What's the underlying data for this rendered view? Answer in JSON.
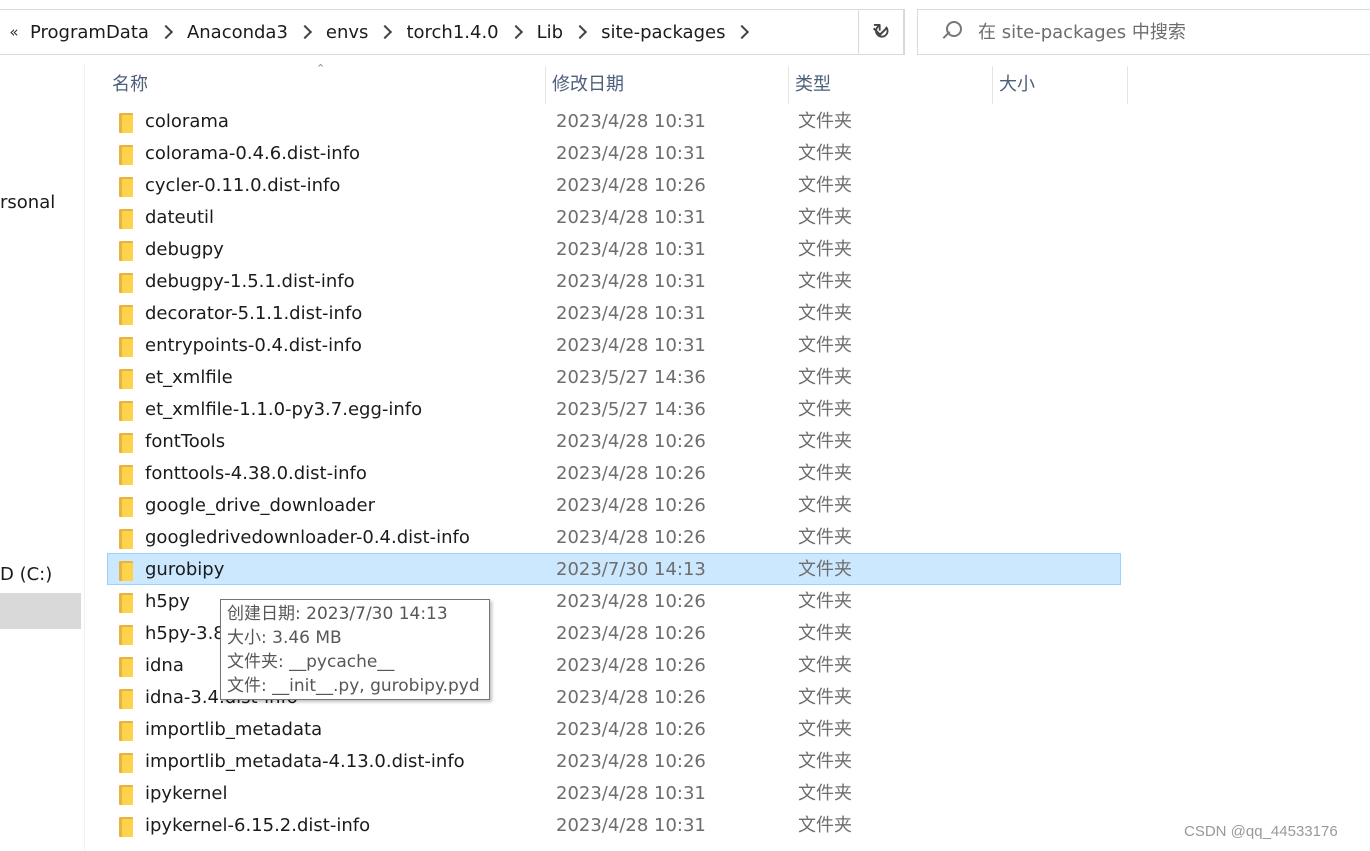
{
  "breadcrumb": [
    "ProgramData",
    "Anaconda3",
    "envs",
    "torch1.4.0",
    "Lib",
    "site-packages"
  ],
  "overflow_glyph": "«",
  "search": {
    "placeholder": "在 site-packages 中搜索"
  },
  "nav": {
    "items": [
      "rsonal",
      "D (C:)"
    ]
  },
  "columns": {
    "name": "名称",
    "date": "修改日期",
    "type": "类型",
    "size": "大小"
  },
  "rows": [
    {
      "name": "colorama",
      "date": "2023/4/28 10:31",
      "type": "文件夹"
    },
    {
      "name": "colorama-0.4.6.dist-info",
      "date": "2023/4/28 10:31",
      "type": "文件夹"
    },
    {
      "name": "cycler-0.11.0.dist-info",
      "date": "2023/4/28 10:26",
      "type": "文件夹"
    },
    {
      "name": "dateutil",
      "date": "2023/4/28 10:31",
      "type": "文件夹"
    },
    {
      "name": "debugpy",
      "date": "2023/4/28 10:31",
      "type": "文件夹"
    },
    {
      "name": "debugpy-1.5.1.dist-info",
      "date": "2023/4/28 10:31",
      "type": "文件夹"
    },
    {
      "name": "decorator-5.1.1.dist-info",
      "date": "2023/4/28 10:31",
      "type": "文件夹"
    },
    {
      "name": "entrypoints-0.4.dist-info",
      "date": "2023/4/28 10:31",
      "type": "文件夹"
    },
    {
      "name": "et_xmlfile",
      "date": "2023/5/27 14:36",
      "type": "文件夹"
    },
    {
      "name": "et_xmlfile-1.1.0-py3.7.egg-info",
      "date": "2023/5/27 14:36",
      "type": "文件夹"
    },
    {
      "name": "fontTools",
      "date": "2023/4/28 10:26",
      "type": "文件夹"
    },
    {
      "name": "fonttools-4.38.0.dist-info",
      "date": "2023/4/28 10:26",
      "type": "文件夹"
    },
    {
      "name": "google_drive_downloader",
      "date": "2023/4/28 10:26",
      "type": "文件夹"
    },
    {
      "name": "googledrivedownloader-0.4.dist-info",
      "date": "2023/4/28 10:26",
      "type": "文件夹"
    },
    {
      "name": "gurobipy",
      "date": "2023/7/30 14:13",
      "type": "文件夹",
      "selected": true
    },
    {
      "name": "h5py",
      "date": "2023/4/28 10:26",
      "type": "文件夹"
    },
    {
      "name": "h5py-3.8",
      "date": "2023/4/28 10:26",
      "type": "文件夹"
    },
    {
      "name": "idna",
      "date": "2023/4/28 10:26",
      "type": "文件夹"
    },
    {
      "name": "idna-3.4.dist-info",
      "date": "2023/4/28 10:26",
      "type": "文件夹"
    },
    {
      "name": "importlib_metadata",
      "date": "2023/4/28 10:26",
      "type": "文件夹"
    },
    {
      "name": "importlib_metadata-4.13.0.dist-info",
      "date": "2023/4/28 10:26",
      "type": "文件夹"
    },
    {
      "name": "ipykernel",
      "date": "2023/4/28 10:31",
      "type": "文件夹"
    },
    {
      "name": "ipykernel-6.15.2.dist-info",
      "date": "2023/4/28 10:31",
      "type": "文件夹"
    }
  ],
  "tooltip": {
    "created": "创建日期: 2023/7/30 14:13",
    "size": "大小: 3.46 MB",
    "folders": "文件夹: __pycache__",
    "files": "文件: __init__.py, gurobipy.pyd"
  },
  "watermark": "CSDN @qq_44533176",
  "colors": {
    "selection": "#cce8ff",
    "selection_border": "#99d1ff",
    "folder": "#ffd24c",
    "header_text": "#4c607a"
  }
}
